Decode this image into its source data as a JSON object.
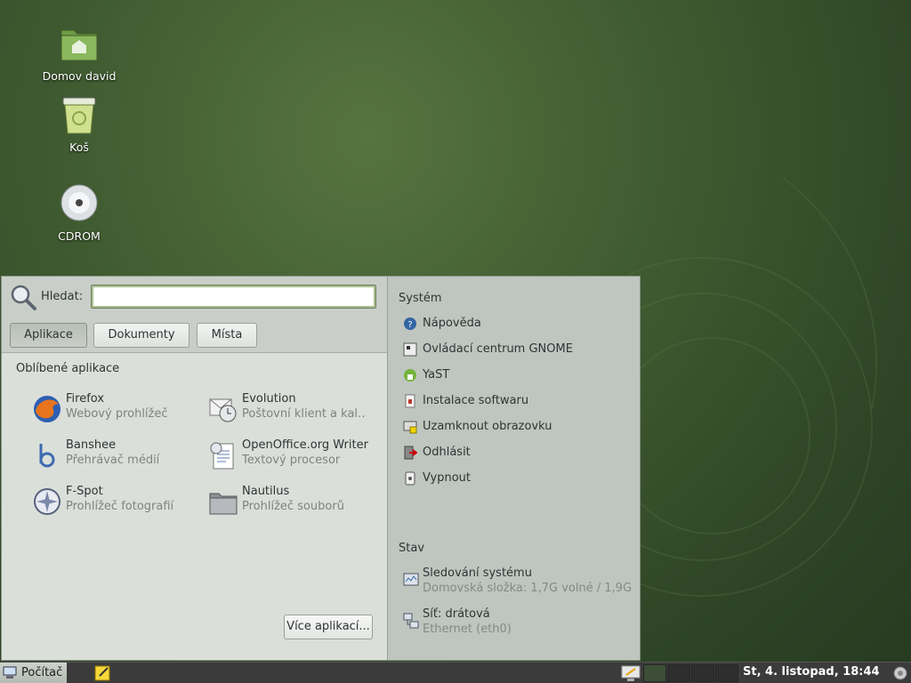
{
  "desktop": {
    "icons": [
      {
        "label": "Domov david",
        "icon": "home-folder-icon"
      },
      {
        "label": "Koš",
        "icon": "trash-icon"
      },
      {
        "label": "CDROM",
        "icon": "cdrom-icon"
      }
    ]
  },
  "menu": {
    "search": {
      "label": "Hledat:",
      "value": "",
      "placeholder": ""
    },
    "tabs": [
      {
        "label": "Aplikace",
        "active": true
      },
      {
        "label": "Dokumenty",
        "active": false
      },
      {
        "label": "Místa",
        "active": false
      }
    ],
    "favorites_title": "Oblíbené aplikace",
    "apps": [
      {
        "name": "Firefox",
        "desc": "Webový prohlížeč",
        "icon": "firefox-icon"
      },
      {
        "name": "Evolution",
        "desc": "Poštovní klient a kal…",
        "icon": "evolution-icon"
      },
      {
        "name": "Banshee",
        "desc": "Přehrávač médií",
        "icon": "banshee-icon"
      },
      {
        "name": "OpenOffice.org Writer",
        "desc": "Textový procesor",
        "icon": "writer-icon"
      },
      {
        "name": "F-Spot",
        "desc": "Prohlížeč fotografií",
        "icon": "fspot-icon"
      },
      {
        "name": "Nautilus",
        "desc": "Prohlížeč souborů",
        "icon": "nautilus-icon"
      }
    ],
    "more_button": "Více aplikací...",
    "system": {
      "title": "Systém",
      "items": [
        {
          "label": "Nápověda",
          "icon": "help-icon"
        },
        {
          "label": "Ovládací centrum GNOME",
          "icon": "control-center-icon"
        },
        {
          "label": "YaST",
          "icon": "yast-icon"
        },
        {
          "label": "Instalace softwaru",
          "icon": "install-software-icon"
        },
        {
          "label": "Uzamknout obrazovku",
          "icon": "lock-screen-icon"
        },
        {
          "label": "Odhlásit",
          "icon": "logout-icon"
        },
        {
          "label": "Vypnout",
          "icon": "shutdown-icon"
        }
      ]
    },
    "status": {
      "title": "Stav",
      "items": [
        {
          "label": "Sledování systému",
          "sub": "Domovská složka: 1,7G volné / 1,9G",
          "icon": "system-monitor-icon"
        },
        {
          "label": "Síť: drátová",
          "sub": "Ethernet (eth0)",
          "icon": "network-icon"
        }
      ]
    }
  },
  "panel": {
    "start_label": "Počítač",
    "clock": "St,  4. listopad, 18:44"
  },
  "colors": {
    "desktop": "#3f5a30",
    "menu_left": "#dadfd9",
    "menu_right": "#bfc6bf",
    "panel": "#3b3b3b"
  }
}
